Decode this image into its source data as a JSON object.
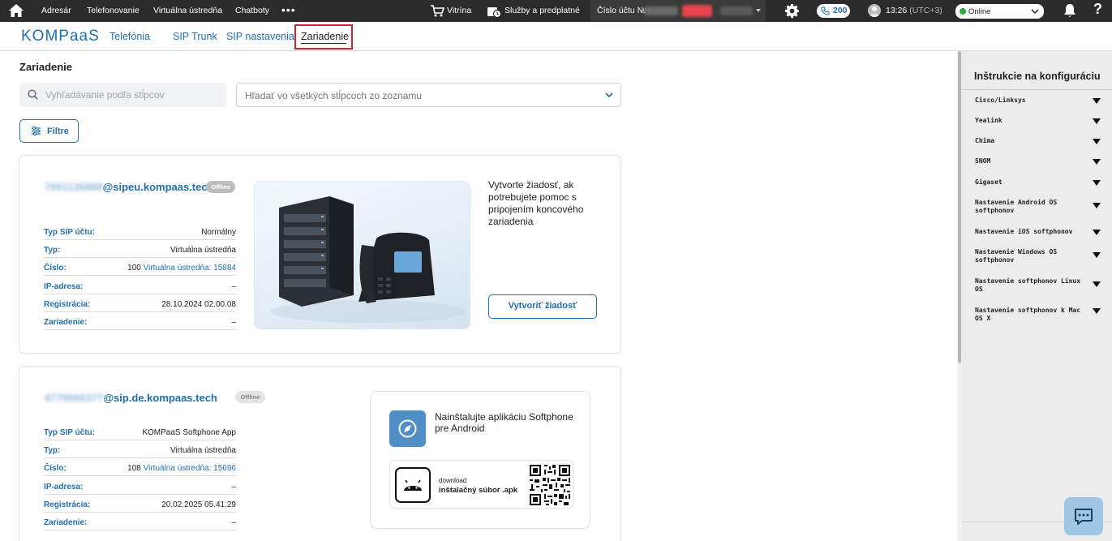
{
  "topbar": {
    "nav": [
      "Adresár",
      "Telefonovanie",
      "Virtuálna ústredňa",
      "Chatboty"
    ],
    "more": "•••",
    "showcase": "Vitrína",
    "services": "Služby a predplatné",
    "account_label": "Číslo účtu №",
    "calls": "200",
    "time": "13:26",
    "timezone": "(UTC+3)",
    "status": "Online"
  },
  "subnav": {
    "logo": "KOMPaaS",
    "tabs": [
      "Telefónia",
      "SIP Trunk",
      "SIP nastavenia",
      "Zariadenie"
    ]
  },
  "main": {
    "title": "Zariadenie",
    "search_placeholder": "Vyhľadávanie podľa stĺpcov",
    "columns_placeholder": "Hľadať vo všetkých stĺpcoch zo zoznamu",
    "filter_label": "Filtre"
  },
  "devices": [
    {
      "username": "7651135888",
      "domain": "@sipeu.kompaas.tech",
      "status": "Offline",
      "rows": [
        {
          "k": "Typ SIP účtu:",
          "v": "Normálny"
        },
        {
          "k": "Typ:",
          "v": "Virtuálna ústredňa"
        },
        {
          "k": "Číslo:",
          "v": "100",
          "link": "Virtuálna ústredňa: 15884"
        },
        {
          "k": "IP-adresa:",
          "v": "–"
        },
        {
          "k": "Registrácia:",
          "v": "28.10.2024 02.00.08"
        },
        {
          "k": "Zariadenie:",
          "v": "–"
        }
      ],
      "help_text": "Vytvorte žiadosť, ak potrebujete pomoc s pripojením koncového zariadenia",
      "help_button": "Vytvoriť žiadosť"
    },
    {
      "username": "4779565377",
      "domain": "@sip.de.kompaas.tech",
      "status": "Offline",
      "rows": [
        {
          "k": "Typ SIP účtu:",
          "v": "KOMPaaS Softphone App"
        },
        {
          "k": "Typ:",
          "v": "Virtuálna ústredňa"
        },
        {
          "k": "Číslo:",
          "v": "108",
          "link": "Virtuálna ústredňa: 15696"
        },
        {
          "k": "IP-adresa:",
          "v": "–"
        },
        {
          "k": "Registrácia:",
          "v": "20.02.2025 05.41.29"
        },
        {
          "k": "Zariadenie:",
          "v": "–"
        }
      ],
      "app_text": "Nainštalujte aplikáciu Softphone pre Android",
      "apk_download": "download",
      "apk_file": "inštalačný súbor .apk"
    }
  ],
  "right_panel": {
    "title": "Inštrukcie na konfiguráciu",
    "items": [
      "Cisco/Linksys",
      "Yealink",
      "Chima",
      "SNOM",
      "Gigaset",
      "Nastavenie Android OS softphonov",
      "Nastavenie iOS softphonov",
      "Nastavenie Windows OS softphonov",
      "Nastavenie softphonov Linux OS",
      "Nastavenie softphonov k Mac OS X"
    ]
  },
  "colors": {
    "accent": "#1f6fb0",
    "topbar": "#2b2b2b",
    "highlight": "#d0202b",
    "online": "#2eaa45"
  }
}
